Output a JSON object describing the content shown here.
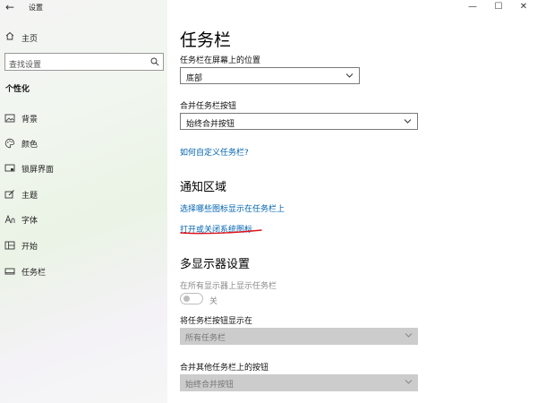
{
  "window": {
    "app_title": "设置",
    "back_glyph": "←",
    "minimize_glyph": "—",
    "maximize_glyph": "☐",
    "close_glyph": "✕"
  },
  "sidebar": {
    "home_label": "主页",
    "search_placeholder": "查找设置",
    "section_title": "个性化",
    "items": [
      {
        "label": "背景",
        "icon": "image-icon"
      },
      {
        "label": "颜色",
        "icon": "palette-icon"
      },
      {
        "label": "锁屏界面",
        "icon": "lock-screen-icon"
      },
      {
        "label": "主题",
        "icon": "theme-icon"
      },
      {
        "label": "字体",
        "icon": "font-icon"
      },
      {
        "label": "开始",
        "icon": "start-icon"
      },
      {
        "label": "任务栏",
        "icon": "taskbar-icon"
      }
    ]
  },
  "main": {
    "title": "任务栏",
    "position_label": "任务栏在屏幕上的位置",
    "position_value": "底部",
    "combine_label": "合并任务栏按钮",
    "combine_value": "始终合并按钮",
    "customize_link": "如何自定义任务栏?",
    "notify_heading": "通知区域",
    "notify_link_1": "选择哪些图标显示在任务栏上",
    "notify_link_2": "打开或关闭系统图标",
    "multi_heading": "多显示器设置",
    "multi_show_label": "在所有显示器上显示任务栏",
    "multi_toggle_state": "关",
    "multi_buttons_label": "将任务栏按钮显示在",
    "multi_buttons_value": "所有任务栏",
    "multi_combine_label": "合并其他任务栏上的按钮",
    "multi_combine_value": "始终合并按钮"
  },
  "colors": {
    "link": "#0063b1",
    "annotation": "#e0121b",
    "disabled_fill": "#cccccc"
  }
}
